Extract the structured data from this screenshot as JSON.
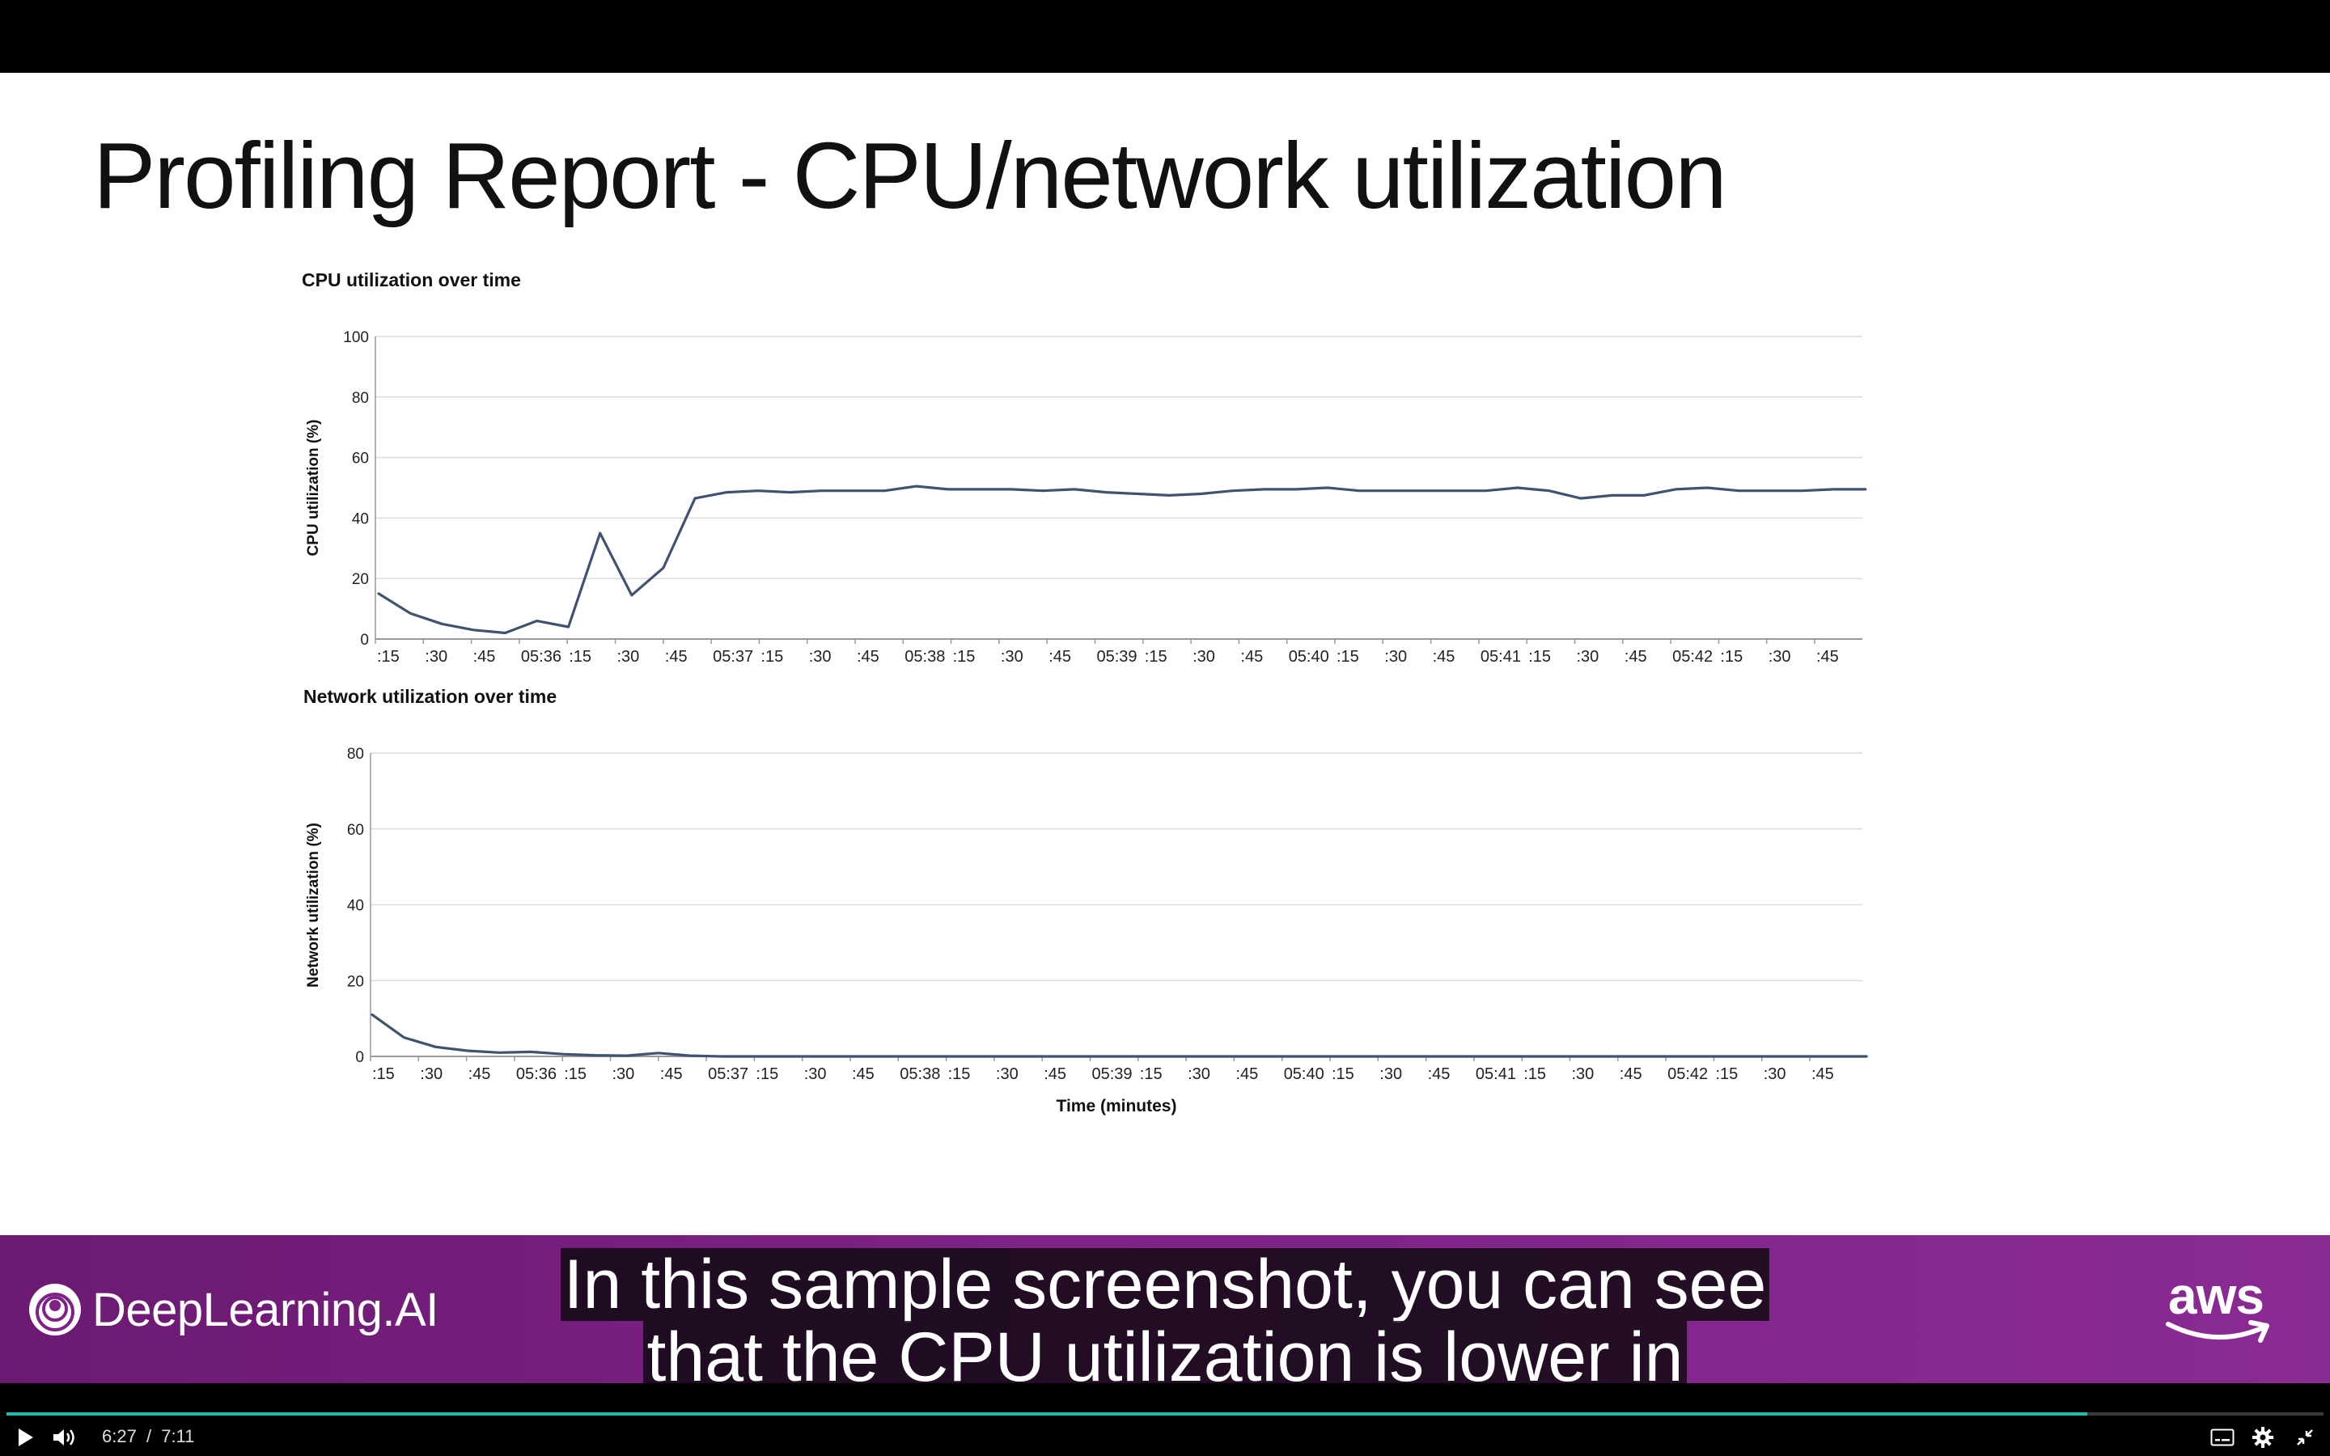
{
  "slide": {
    "title": "Profiling Report - CPU/network utilization"
  },
  "charts": {
    "cpu": {
      "title": "CPU utilization over time",
      "ylabel": "CPU utilization (%)",
      "y_ticks": [
        "100",
        "80",
        "60",
        "40",
        "20",
        "0"
      ]
    },
    "network": {
      "title": "Network utilization over time",
      "ylabel": "Network utilization (%)",
      "xlabel": "Time (minutes)",
      "y_ticks": [
        "80",
        "60",
        "40",
        "20",
        "0"
      ]
    },
    "x_ticks": [
      ":15",
      ":30",
      ":45",
      "05:36",
      ":15",
      ":30",
      ":45",
      "05:37",
      ":15",
      ":30",
      ":45",
      "05:38",
      ":15",
      ":30",
      ":45",
      "05:39",
      ":15",
      ":30",
      ":45",
      "05:40",
      ":15",
      ":30",
      ":45",
      "05:41",
      ":15",
      ":30",
      ":45",
      "05:42",
      ":15",
      ":30",
      ":45"
    ]
  },
  "chart_data": [
    {
      "type": "line",
      "title": "CPU utilization over time",
      "ylabel": "CPU utilization (%)",
      "xlabel": "",
      "ylim": [
        0,
        100
      ],
      "x_tick_labels": [
        ":15",
        ":30",
        ":45",
        "05:36",
        ":15",
        ":30",
        ":45",
        "05:37",
        ":15",
        ":30",
        ":45",
        "05:38",
        ":15",
        ":30",
        ":45",
        "05:39",
        ":15",
        ":30",
        ":45",
        "05:40",
        ":15",
        ":30",
        ":45",
        "05:41",
        ":15",
        ":30",
        ":45",
        "05:42",
        ":15",
        ":30",
        ":45"
      ],
      "grid": true,
      "series": [
        {
          "color": "#3f5370",
          "values": [
            15,
            8.5,
            5,
            3,
            2,
            6,
            4,
            35,
            14.5,
            23.5,
            46.5,
            48.5,
            49,
            48.5,
            49,
            49,
            49,
            50.5,
            49.5,
            49.5,
            49.5,
            49,
            49.5,
            48.5,
            48,
            47.5,
            48,
            49,
            49.5,
            49.5,
            50,
            49,
            49,
            49,
            49,
            49,
            50,
            49,
            46.5,
            47.5,
            47.5,
            49.5,
            50,
            49,
            49,
            49,
            49.5,
            49.5
          ]
        }
      ]
    },
    {
      "type": "line",
      "title": "Network utilization over time",
      "ylabel": "Network utilization (%)",
      "xlabel": "Time (minutes)",
      "ylim": [
        0,
        80
      ],
      "x_tick_labels": [
        ":15",
        ":30",
        ":45",
        "05:36",
        ":15",
        ":30",
        ":45",
        "05:37",
        ":15",
        ":30",
        ":45",
        "05:38",
        ":15",
        ":30",
        ":45",
        "05:39",
        ":15",
        ":30",
        ":45",
        "05:40",
        ":15",
        ":30",
        ":45",
        "05:41",
        ":15",
        ":30",
        ":45",
        "05:42",
        ":15",
        ":30",
        ":45"
      ],
      "grid": true,
      "series": [
        {
          "color": "#3f5370",
          "values": [
            11,
            5,
            2.5,
            1.5,
            1,
            1.2,
            0.6,
            0.3,
            0.2,
            0.9,
            0.2,
            0,
            0,
            0,
            0,
            0,
            0,
            0,
            0,
            0,
            0,
            0,
            0,
            0,
            0,
            0,
            0,
            0,
            0,
            0,
            0,
            0,
            0,
            0,
            0,
            0,
            0,
            0,
            0,
            0,
            0,
            0,
            0,
            0,
            0,
            0,
            0,
            0
          ]
        }
      ]
    }
  ],
  "branding": {
    "left_logo": "DeepLearning.AI",
    "right_logo": "aws",
    "band_color": "#7e2287"
  },
  "caption": {
    "line1": "In this sample screenshot, you can see",
    "line2": "that the CPU utilization is lower in"
  },
  "player": {
    "current_time": "6:27",
    "separator": "/",
    "duration": "7:11",
    "progress": 0.898,
    "accent_color": "#1fb8a9",
    "icons": [
      "play-icon",
      "volume-icon",
      "captions-icon",
      "settings-icon",
      "exit-fullscreen-icon"
    ]
  }
}
